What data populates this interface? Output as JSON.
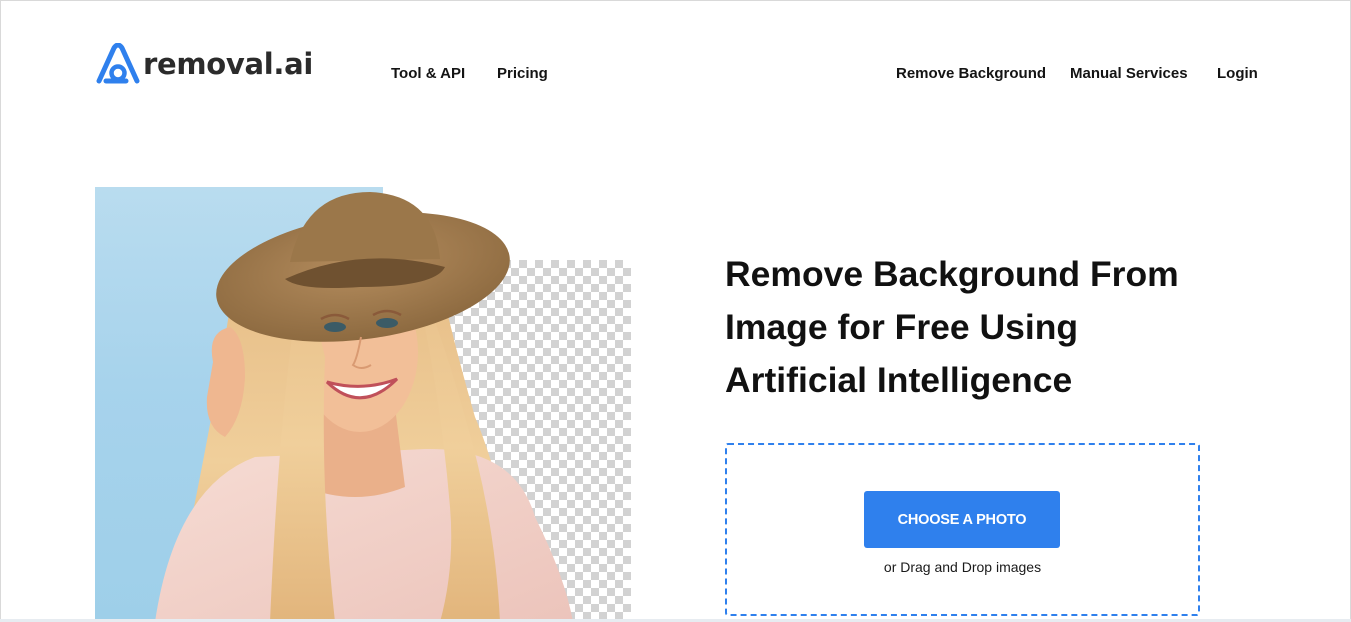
{
  "brand": {
    "name": "removal.ai",
    "accent_color": "#2F80ED",
    "text_color": "#2B2B2B"
  },
  "nav": {
    "left": [
      {
        "label": "Tool & API"
      },
      {
        "label": "Pricing"
      }
    ],
    "right": [
      {
        "label": "Remove Background"
      },
      {
        "label": "Manual Services"
      },
      {
        "label": "Login"
      }
    ]
  },
  "hero": {
    "headline_lines": [
      "Remove Background From",
      "Image for Free Using",
      "Artificial Intelligence"
    ],
    "image_description": "woman-with-sun-hat-background-removal-demo"
  },
  "upload": {
    "button_label": "CHOOSE A PHOTO",
    "hint": "or Drag and Drop images",
    "button_color": "#2F80ED"
  }
}
